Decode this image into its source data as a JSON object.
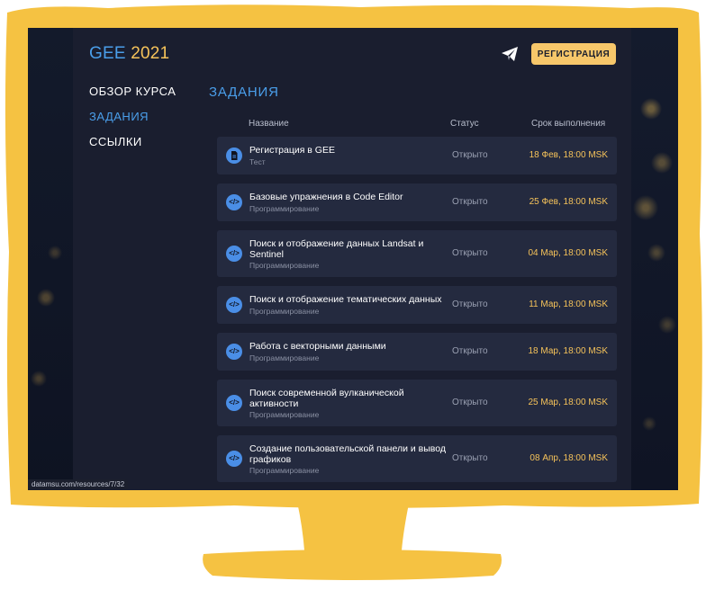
{
  "colors": {
    "frame": "#f5c242",
    "accent_blue": "#4a9eea",
    "accent_yellow": "#f6c35a",
    "panel": "#1a1e2f",
    "row": "#242a3f"
  },
  "logo": {
    "gee": "GEE",
    "year": "2021"
  },
  "header": {
    "register_label": "РЕГИСТРАЦИЯ",
    "telegram_icon": "paper-plane-icon"
  },
  "sidebar": {
    "items": [
      {
        "label": "ОБЗОР КУРСА",
        "active": false
      },
      {
        "label": "ЗАДАНИЯ",
        "active": true
      },
      {
        "label": "ССЫЛКИ",
        "active": false
      }
    ]
  },
  "main": {
    "section_title": "ЗАДАНИЯ",
    "columns": {
      "name": "Название",
      "status": "Статус",
      "due": "Срок выполнения"
    },
    "tasks": [
      {
        "title": "Регистрация в GEE",
        "category": "Тест",
        "status": "Открыто",
        "due": "18 Фев, 18:00 MSK",
        "icon": "document-icon"
      },
      {
        "title": "Базовые упражнения в Code Editor",
        "category": "Программирование",
        "status": "Открыто",
        "due": "25 Фев, 18:00 MSK",
        "icon": "code-icon"
      },
      {
        "title": "Поиск и отображение данных Landsat и Sentinel",
        "category": "Программирование",
        "status": "Открыто",
        "due": "04 Мар, 18:00 MSK",
        "icon": "code-icon"
      },
      {
        "title": "Поиск и отображение тематических данных",
        "category": "Программирование",
        "status": "Открыто",
        "due": "11 Мар, 18:00 MSK",
        "icon": "code-icon"
      },
      {
        "title": "Работа с векторными данными",
        "category": "Программирование",
        "status": "Открыто",
        "due": "18 Мар, 18:00 MSK",
        "icon": "code-icon"
      },
      {
        "title": "Поиск современной вулканической активности",
        "category": "Программирование",
        "status": "Открыто",
        "due": "25 Мар, 18:00 MSK",
        "icon": "code-icon"
      },
      {
        "title": "Создание пользовательской панели и вывод графиков",
        "category": "Программирование",
        "status": "Открыто",
        "due": "08 Апр, 18:00 MSK",
        "icon": "code-icon"
      }
    ]
  },
  "status_url": "datamsu.com/resources/7/32"
}
